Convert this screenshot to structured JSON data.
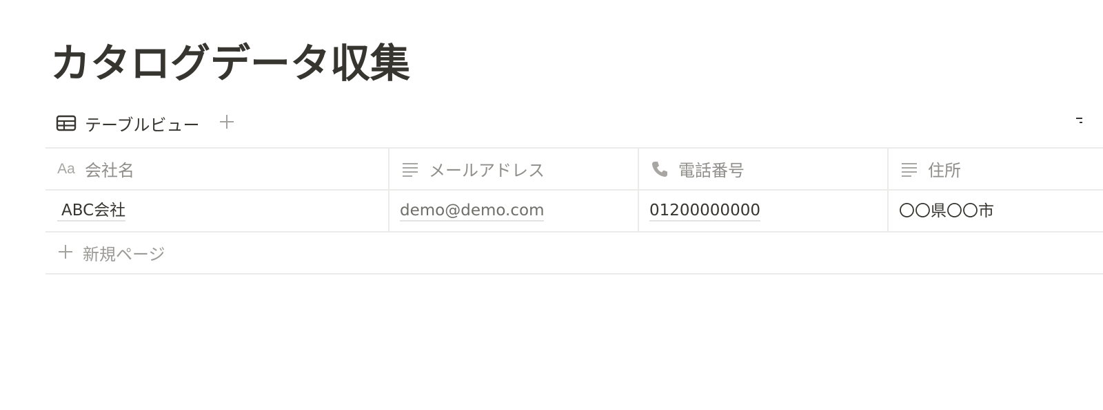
{
  "page": {
    "title": "カタログデータ収集"
  },
  "views": {
    "active_label": "テーブルビュー",
    "icon": "table-icon",
    "add_icon": "plus-icon"
  },
  "table": {
    "columns": [
      {
        "label": "会社名",
        "icon": "title-aa-icon"
      },
      {
        "label": "メールアドレス",
        "icon": "text-lines-icon"
      },
      {
        "label": "電話番号",
        "icon": "phone-icon"
      },
      {
        "label": "住所",
        "icon": "text-lines-icon"
      }
    ],
    "rows": [
      {
        "company": "ABC会社",
        "email": "demo@demo.com",
        "phone": "01200000000",
        "address": "〇〇県〇〇市"
      }
    ],
    "title_icon_text": "Aa",
    "new_page_label": "新規ページ"
  },
  "colors": {
    "text": "#37352f",
    "muted": "#9b9a97",
    "border": "#ebebea"
  }
}
